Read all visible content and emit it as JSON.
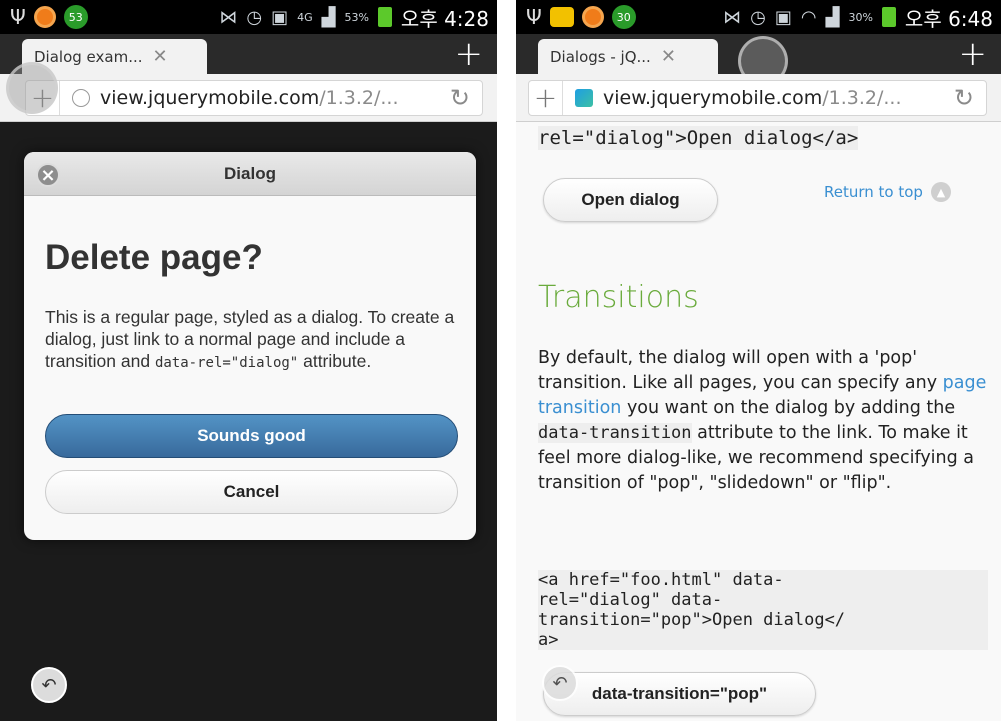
{
  "left": {
    "status": {
      "notif_count": "53",
      "network": "4G",
      "battery": "53%",
      "time": "오후 4:28"
    },
    "tab": {
      "title": "Dialog exam...",
      "close": "✕"
    },
    "url": {
      "domain": "view.jquerymobile.com",
      "path": "/1.3.2/..."
    },
    "dialog": {
      "title": "Dialog",
      "heading": "Delete page?",
      "body_before": "This is a regular page, styled as a dialog. To create a dialog, just link to a normal page and include a transition and ",
      "body_code": "data-rel=\"dialog\"",
      "body_after": " attribute.",
      "primary_button": "Sounds good",
      "secondary_button": "Cancel"
    }
  },
  "right": {
    "status": {
      "notif_count": "30",
      "battery": "30%",
      "time": "오후 6:48"
    },
    "tab": {
      "title": "Dialogs - jQ...",
      "close": "✕"
    },
    "url": {
      "domain": "view.jquerymobile.com",
      "path": "/1.3.2/..."
    },
    "content": {
      "top_code": "rel=\"dialog\">Open dialog</a>",
      "open_dialog_button": "Open dialog",
      "return_to_top": "Return to top",
      "heading": "Transitions",
      "para_1": "By default, the dialog will open with a 'pop' transition. Like all pages, you can specify any ",
      "para_link": "page transition",
      "para_2": " you want on the dialog by adding the ",
      "para_code": "data-transition",
      "para_3": " attribute to the link. To make it feel more dialog-like, we recommend specifying a transition of \"pop\", \"slidedown\" or \"flip\".",
      "code_block": "<a href=\"foo.html\" data-\nrel=\"dialog\" data-\ntransition=\"pop\">Open dialog</\na>",
      "pop_button": "data-transition=\"pop\""
    }
  },
  "colors": {
    "primary_button": "#4a86bd",
    "link": "#3a8fd1",
    "heading_green": "#6aab3c"
  }
}
